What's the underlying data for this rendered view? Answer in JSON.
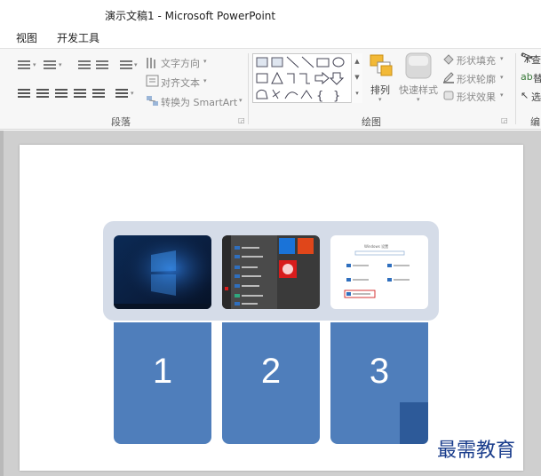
{
  "window": {
    "title": "演示文稿1 - Microsoft PowerPoint"
  },
  "menu": {
    "items": [
      "视图",
      "开发工具"
    ]
  },
  "ribbon": {
    "paragraph": {
      "label": "段落",
      "text_direction": "文字方向",
      "align_text": "对齐文本",
      "convert_smartart": "转换为 SmartArt"
    },
    "drawing": {
      "label": "绘图",
      "arrange": "排列",
      "quick_styles": "快速样式",
      "shape_fill": "形状填充",
      "shape_outline": "形状轮廓",
      "shape_effects": "形状效果"
    },
    "right_partial": [
      "查",
      "替",
      "选"
    ]
  },
  "slide": {
    "cards": [
      "1",
      "2",
      "3"
    ],
    "screenshots": [
      {
        "name": "windows-desktop"
      },
      {
        "name": "start-menu"
      },
      {
        "name": "windows-settings",
        "heading": "Windows 设置"
      }
    ]
  },
  "watermark": "最需教育",
  "colors": {
    "card_blue": "#4f7ebb",
    "panel_bg": "#d5dce8",
    "ribbon_bg": "#f7f7f7",
    "workspace_bg": "#cfcfcf",
    "watermark": "#1a3d8c"
  }
}
